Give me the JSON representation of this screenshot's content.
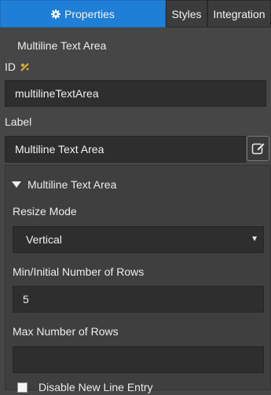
{
  "tabs": {
    "properties": "Properties",
    "styles": "Styles",
    "integration": "Integration"
  },
  "component_title": "Multiline Text Area",
  "id_field": {
    "label": "ID",
    "value": "multilineTextArea"
  },
  "label_field": {
    "label": "Label",
    "value": "Multiline Text Area"
  },
  "section": {
    "title": "Multiline Text Area",
    "resize_mode": {
      "label": "Resize Mode",
      "value": "Vertical"
    },
    "min_rows": {
      "label": "Min/Initial Number of Rows",
      "value": "5"
    },
    "max_rows": {
      "label": "Max Number of Rows",
      "value": ""
    },
    "disable_new_line": {
      "label": "Disable New Line Entry",
      "checked": false
    }
  },
  "colors": {
    "accent": "#1f7fd6",
    "background": "#464646"
  }
}
